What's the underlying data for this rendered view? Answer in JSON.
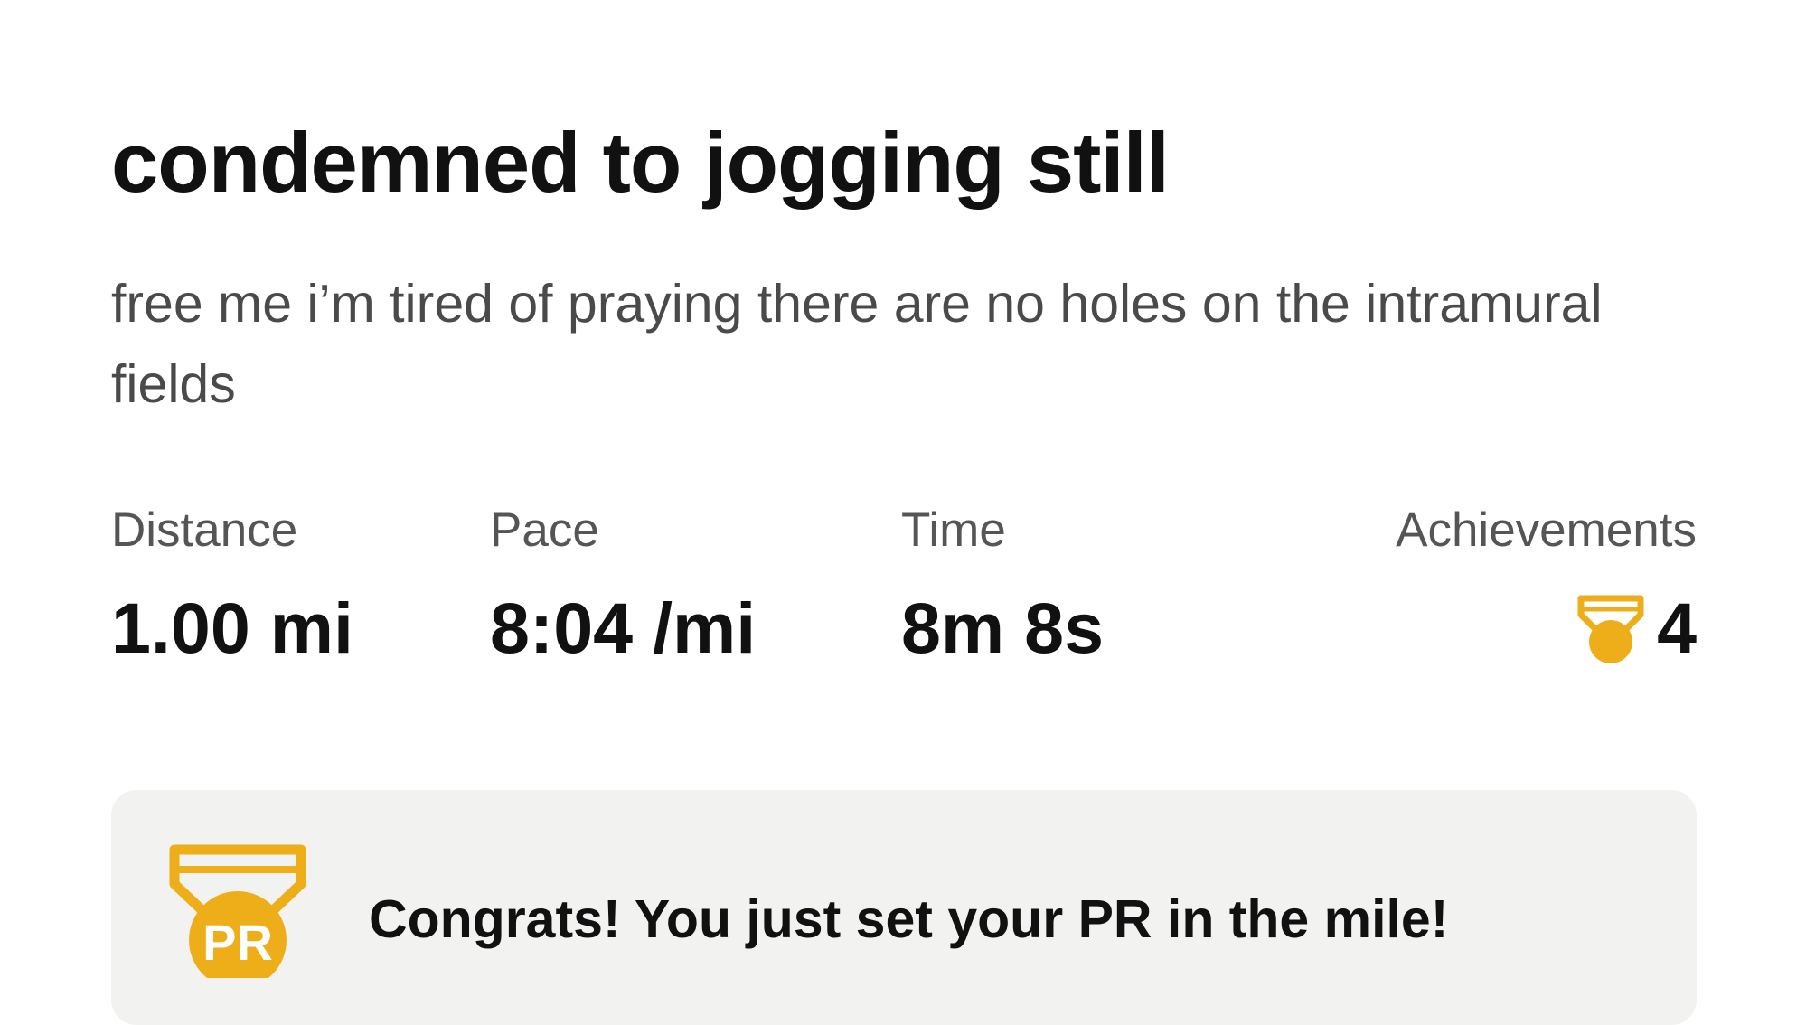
{
  "activity": {
    "title": "condemned to jogging still",
    "description": "free me i’m tired of praying there are no holes on the intramural fields"
  },
  "stats": {
    "distance": {
      "label": "Distance",
      "value": "1.00 mi"
    },
    "pace": {
      "label": "Pace",
      "value": "8:04 /mi"
    },
    "time": {
      "label": "Time",
      "value": "8m 8s"
    },
    "achievements": {
      "label": "Achievements",
      "count": "4",
      "icon": "medal-icon"
    }
  },
  "banner": {
    "icon": "pr-medal-icon",
    "icon_text": "PR",
    "message": "Congrats! You just set your PR in the mile!"
  },
  "colors": {
    "accent_gold": "#EDAE1A",
    "banner_background": "#F2F2F0",
    "text_primary": "#111111",
    "text_secondary": "#4A4A4A"
  }
}
